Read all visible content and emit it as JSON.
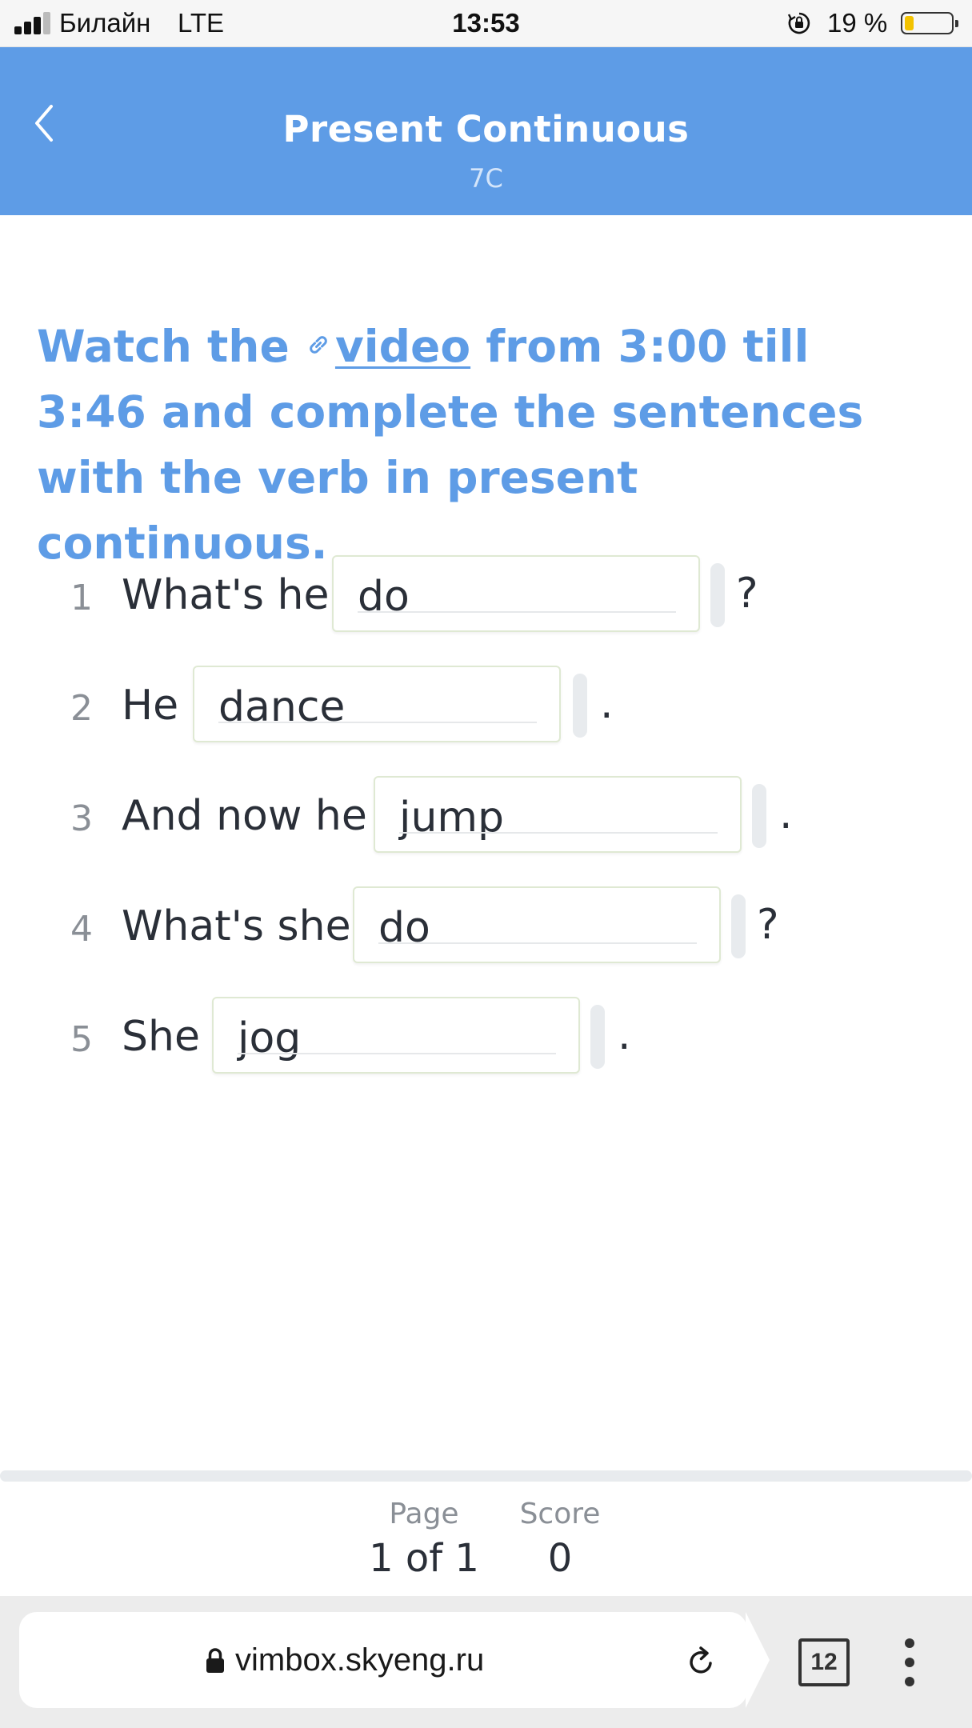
{
  "status": {
    "carrier": "Билайн",
    "network": "LTE",
    "time": "13:53",
    "battery": "19 %",
    "battery_level": 0.19,
    "battery_color": "#f2c200",
    "icons": [
      "signal-icon",
      "rotation-lock-icon",
      "battery-icon"
    ]
  },
  "header": {
    "title": "Present Continuous",
    "subtitle": "7C",
    "back_icon": "chevron-left-icon",
    "bg_color": "#5e9ce6"
  },
  "instruction": {
    "before": "Watch the",
    "link_text": "video",
    "after": " from 3:00 till 3:46 and complete the sentences with the verb in present continuous.",
    "link_icon": "link-icon",
    "color": "#5e9ce6"
  },
  "items": [
    {
      "number": "1",
      "text": "What's he",
      "answer": "do",
      "punct": "?"
    },
    {
      "number": "2",
      "text": "He",
      "answer": "dance",
      "punct": "."
    },
    {
      "number": "3",
      "text": "And now he",
      "answer": "jump",
      "punct": "."
    },
    {
      "number": "4",
      "text": "What's she",
      "answer": "do",
      "punct": "?"
    },
    {
      "number": "5",
      "text": "She",
      "answer": "jog",
      "punct": "."
    }
  ],
  "footer": {
    "page_label": "Page",
    "page_value": "1 of 1",
    "score_label": "Score",
    "score_value": "0"
  },
  "browser": {
    "url": "vimbox.skyeng.ru",
    "tab_count": "12",
    "icons": [
      "lock-icon",
      "reload-icon",
      "tabs-icon",
      "menu-icon"
    ]
  }
}
